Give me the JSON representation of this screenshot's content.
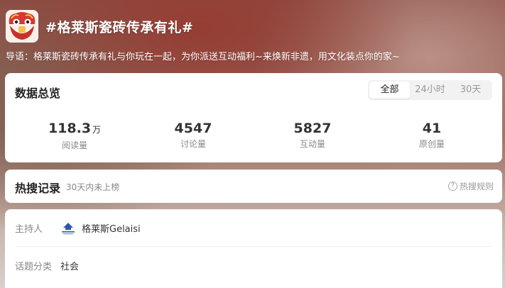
{
  "topic": {
    "title": "#格莱斯瓷砖传承有礼#",
    "intro": "导语：格莱斯瓷砖传承有礼与你玩在一起，为你派送互动福利~来焕新非遗，用文化装点你的家~"
  },
  "stats": {
    "title": "数据总览",
    "tabs": [
      "全部",
      "24小时",
      "30天"
    ],
    "active_tab": "全部",
    "items": [
      {
        "value": "118.3",
        "unit": "万",
        "label": "阅读量"
      },
      {
        "value": "4547",
        "unit": "",
        "label": "讨论量"
      },
      {
        "value": "5827",
        "unit": "",
        "label": "互动量"
      },
      {
        "value": "41",
        "unit": "",
        "label": "原创量"
      }
    ]
  },
  "hot": {
    "title": "热搜记录",
    "subtitle": "30天内未上榜",
    "rule": "热搜规则"
  },
  "info": {
    "host_label": "主持人",
    "host_name": "格莱斯Gelaisi",
    "category_label": "话题分类",
    "category_value": "社会"
  },
  "icons": {
    "avatar": "lion-dance-avatar-icon",
    "rule": "question-circle-icon",
    "host": "gelaisi-logo-icon"
  }
}
